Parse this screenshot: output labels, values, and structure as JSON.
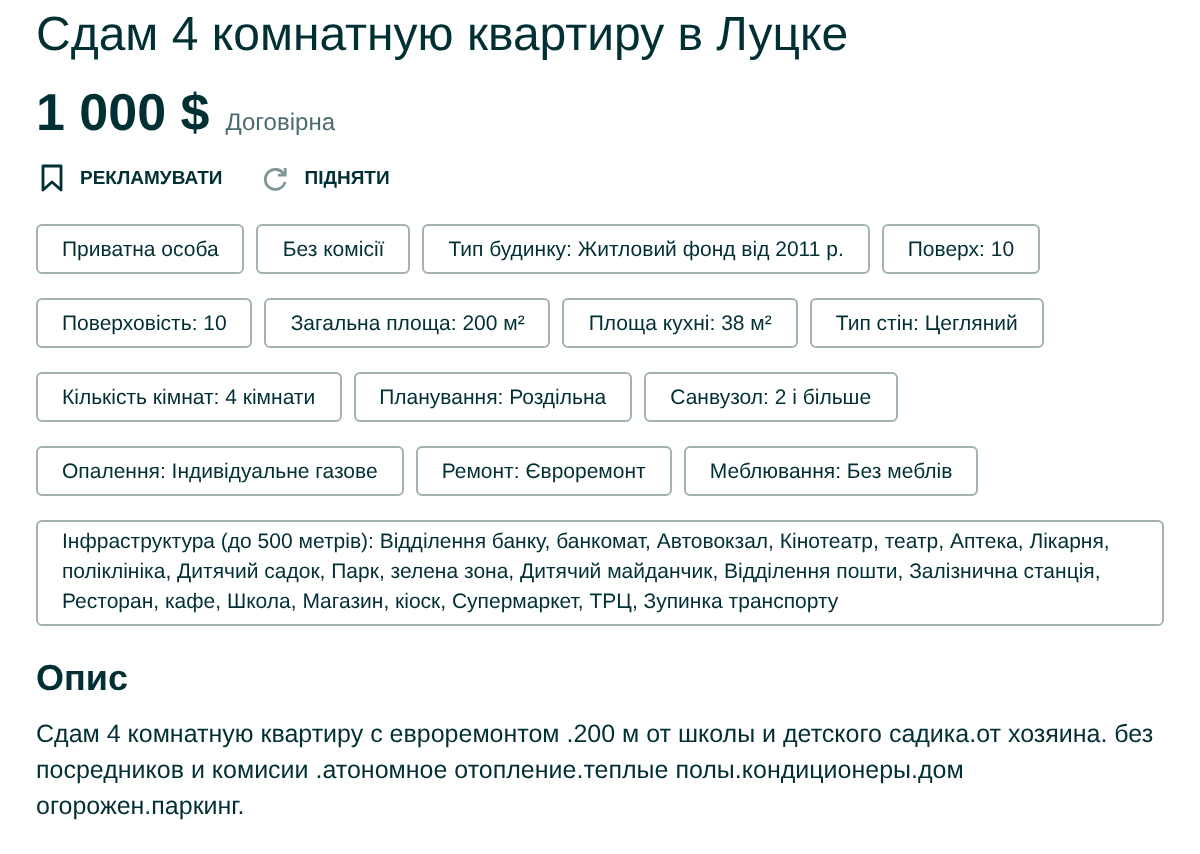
{
  "title": "Сдам 4 комнатную квартиру в Луцке",
  "price": {
    "amount": "1 000 $",
    "note": "Договірна"
  },
  "actions": [
    {
      "kind": "promote",
      "label": "РЕКЛАМУВАТИ"
    },
    {
      "kind": "refresh",
      "label": "ПІДНЯТИ"
    }
  ],
  "tag_rows": [
    [
      "Приватна особа",
      "Без комісії",
      "Тип будинку: Житловий фонд від 2011 р.",
      "Поверх: 10"
    ],
    [
      "Поверховість: 10",
      "Загальна площа: 200 м²",
      "Площа кухні: 38 м²",
      "Тип стін: Цегляний"
    ],
    [
      "Кількість кімнат: 4 кімнати",
      "Планування: Роздільна",
      "Санвузол: 2 і більше"
    ],
    [
      "Опалення: Індивідуальне газове",
      "Ремонт: Євроремонт",
      "Меблювання: Без меблів"
    ],
    [
      "Інфраструктура (до 500 метрів): Відділення банку, банкомат, Автовокзал, Кінотеатр, театр, Аптека, Лікарня, поліклініка, Дитячий садок, Парк, зелена зона, Дитячий майданчик, Відділення пошти, Залізнична станція, Ресторан, кафе, Школа, Магазин, кіоск, Супермаркет, ТРЦ, Зупинка транспорту"
    ]
  ],
  "description": {
    "heading": "Опис",
    "text": "Сдам 4 комнатную квартиру с евроремонтом .200 м от школы и детского садика.от хозяина. без посредников и комисии .атономное отопление.теплые полы.кондиционеры.дом огорожен.паркинг."
  }
}
